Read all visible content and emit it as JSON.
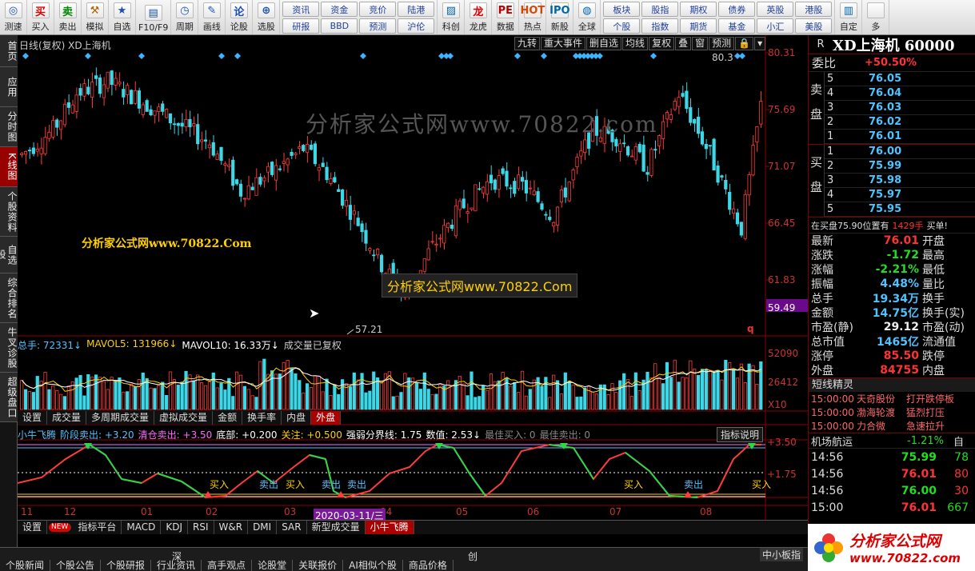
{
  "toolbar": {
    "items": [
      {
        "label": "测速",
        "icon": "speed-icon",
        "glyph": "◎",
        "color": "#1a4fb0"
      },
      {
        "label": "买入",
        "icon": "buy-icon",
        "glyph": "买",
        "color": "#d00"
      },
      {
        "label": "卖出",
        "icon": "sell-icon",
        "glyph": "卖",
        "color": "#080"
      },
      {
        "label": "模拟",
        "icon": "hammer-icon",
        "glyph": "⚒",
        "color": "#b06000"
      },
      {
        "label": "自选",
        "icon": "star-icon",
        "glyph": "★",
        "color": "#1a4fb0"
      },
      {
        "label": "F10/F9",
        "icon": "f10-icon",
        "glyph": "▤",
        "color": "#1a4fb0"
      },
      {
        "label": "周期",
        "icon": "clock-icon",
        "glyph": "◷",
        "color": "#1a4fb0"
      },
      {
        "label": "画线",
        "icon": "pen-icon",
        "glyph": "✎",
        "color": "#1a4fb0"
      },
      {
        "label": "论股",
        "icon": "forum-icon",
        "glyph": "论",
        "color": "#1a4fb0"
      },
      {
        "label": "选股",
        "icon": "search-icon",
        "glyph": "⊕",
        "color": "#1a4fb0"
      }
    ],
    "grid1": [
      "资讯",
      "资金",
      "竞价",
      "陆港",
      "研报",
      "BBD",
      "预测",
      "沪伦"
    ],
    "icons2": [
      {
        "label": "科创",
        "icon": "chart-icon",
        "glyph": "▨",
        "color": "#06a"
      },
      {
        "label": "龙虎",
        "icon": "dragon-icon",
        "glyph": "龙",
        "color": "#d00"
      },
      {
        "label": "数据",
        "icon": "pe-icon",
        "glyph": "PE",
        "color": "#b00"
      },
      {
        "label": "热点",
        "icon": "hot-icon",
        "glyph": "HOT",
        "color": "#d40"
      },
      {
        "label": "新股",
        "icon": "ipo-icon",
        "glyph": "IPO",
        "color": "#06a"
      },
      {
        "label": "全球",
        "icon": "globe-icon",
        "glyph": "◍",
        "color": "#06a"
      }
    ],
    "grid2": [
      "板块",
      "股指",
      "期权",
      "债券",
      "英股",
      "港股",
      "个股",
      "指数",
      "期货",
      "基金",
      "小汇",
      "美股"
    ],
    "tail": [
      {
        "label": "自定",
        "icon": "custom-icon",
        "glyph": "▥",
        "color": "#06a"
      },
      {
        "label": "多",
        "icon": "more-icon",
        "glyph": "",
        "color": "#06a"
      }
    ]
  },
  "sidetabs": [
    "首页",
    "应用",
    "分时图",
    "K线图",
    "个股资料",
    "自选股",
    "综合排名",
    "牛叉诊股",
    "超级盘口"
  ],
  "active_sidetab": 3,
  "main_chart": {
    "header_left": "日线(复权) XD上海机",
    "toolbar_buttons": [
      "九转",
      "重大事件",
      "删自选",
      "均线",
      "复权",
      "叠",
      "窗",
      "预测",
      "🔒",
      "▾"
    ],
    "price_labels": [
      "80.31",
      "75.69",
      "71.07",
      "66.45",
      "61.83",
      "59.49"
    ],
    "high_label": "80.3",
    "low_label": "57.21",
    "watermark": "分析家公式网www.70822.com",
    "watermark2": "分析家公式网www.70822.Com",
    "tooltip": "分析家公式网www.70822.Com",
    "q_mark": "q"
  },
  "volume_panel": {
    "header_segments": [
      {
        "text": "总手: 72331↓",
        "color": "#4fc3ff"
      },
      {
        "text": "MAVOL5: 131966↓",
        "color": "#ffd000"
      },
      {
        "text": "MAVOL10: 16.33万↓",
        "color": "#ffffff"
      },
      {
        "text": "成交量已复权",
        "color": "#cccccc"
      }
    ],
    "scale_labels": [
      "52090",
      "26412",
      "X10"
    ],
    "tabs": [
      "设置",
      "成交量",
      "多周期成交量",
      "虚拟成交量",
      "金额",
      "换手率",
      "内盘",
      "外盘"
    ],
    "active_tab": 7
  },
  "indicator_panel": {
    "header_segments": [
      {
        "text": "小牛飞腾",
        "color": "#4fc3ff"
      },
      {
        "text": "阶段卖出: +3.20",
        "color": "#4fc3ff"
      },
      {
        "text": "清仓卖出: +3.50",
        "color": "#ff66ff"
      },
      {
        "text": "底部: +0.200",
        "color": "#ffffff"
      },
      {
        "text": "关注: +0.500",
        "color": "#ffd000"
      },
      {
        "text": "强弱分界线: 1.75",
        "color": "#ffffff"
      },
      {
        "text": "数值: 2.53↓",
        "color": "#ffffff"
      },
      {
        "text": "最佳买入: 0",
        "color": "#888888"
      },
      {
        "text": "最佳卖出: 0",
        "color": "#888888"
      }
    ],
    "help_button": "指标说明",
    "scale_labels": [
      "+3.50",
      "+1.75"
    ],
    "signals": [
      {
        "text": "买入",
        "color": "#ffd000"
      },
      {
        "text": "卖出",
        "color": "#4fc3ff"
      },
      {
        "text": "买入",
        "color": "#ffd000"
      },
      {
        "text": "卖出",
        "color": "#4fc3ff"
      },
      {
        "text": "买入",
        "color": "#ffd000"
      },
      {
        "text": "卖出",
        "color": "#4fc3ff"
      },
      {
        "text": "买入",
        "color": "#ffd000"
      },
      {
        "text": "卖出",
        "color": "#4fc3ff"
      }
    ]
  },
  "date_axis": {
    "labels": [
      "11",
      "12",
      "01",
      "02",
      "03",
      "04",
      "05",
      "06",
      "07",
      "08"
    ],
    "cursor_date": "2020-03-11/三"
  },
  "indicator_tabs": {
    "items": [
      "设置",
      "NEW",
      "指标平台",
      "MACD",
      "KDJ",
      "RSI",
      "W&R",
      "DMI",
      "SAR",
      "新型成交量",
      "小牛飞腾"
    ],
    "active": 10
  },
  "statusbar": {
    "items": [
      "个股新闻",
      "个股公告",
      "个股研报",
      "行业资讯",
      "高手观点",
      "论股堂",
      "关联报价",
      "AI相似个股",
      "商品价格"
    ],
    "market_left": "深",
    "market_mid": "创",
    "right_label": "中小板指"
  },
  "quote": {
    "header_r": "R",
    "title": "XD上海机 60000",
    "weibi_label": "委比",
    "weibi_value": "+50.50%",
    "sell_label": "卖盘",
    "buy_label": "买盘",
    "sells": [
      {
        "level": "5",
        "price": "76.05"
      },
      {
        "level": "4",
        "price": "76.04"
      },
      {
        "level": "3",
        "price": "76.03"
      },
      {
        "level": "2",
        "price": "76.02"
      },
      {
        "level": "1",
        "price": "76.01"
      }
    ],
    "buys": [
      {
        "level": "1",
        "price": "76.00"
      },
      {
        "level": "2",
        "price": "75.99"
      },
      {
        "level": "3",
        "price": "75.98"
      },
      {
        "level": "4",
        "price": "75.97"
      },
      {
        "level": "5",
        "price": "75.95"
      }
    ],
    "notice_a": "在买盘75.90位置有",
    "notice_b": "1429手",
    "notice_c": "买单!",
    "stats": [
      {
        "l1": "最新",
        "v1": "76.01",
        "c1": "#ff3333",
        "l2": "开盘"
      },
      {
        "l1": "涨跌",
        "v1": "-1.72",
        "c1": "#22dd22",
        "l2": "最高"
      },
      {
        "l1": "涨幅",
        "v1": "-2.21%",
        "c1": "#22dd22",
        "l2": "最低"
      },
      {
        "l1": "振幅",
        "v1": "4.48%",
        "c1": "#4fc3ff",
        "l2": "量比"
      },
      {
        "l1": "总手",
        "v1": "19.34万",
        "c1": "#4fc3ff",
        "l2": "换手"
      },
      {
        "l1": "金额",
        "v1": "14.75亿",
        "c1": "#4fc3ff",
        "l2": "换手(实)"
      },
      {
        "l1": "市盈(静)",
        "v1": "29.12",
        "c1": "#eeeeee",
        "l2": "市盈(动)"
      },
      {
        "l1": "总市值",
        "v1": "1465亿",
        "c1": "#4fc3ff",
        "l2": "流通值"
      },
      {
        "l1": "涨停",
        "v1": "85.50",
        "c1": "#ff3333",
        "l2": "跌停"
      },
      {
        "l1": "外盘",
        "v1": "84755",
        "c1": "#ff3333",
        "l2": "内盘"
      }
    ],
    "elves_title": "短线精灵",
    "elves": [
      {
        "time": "15:00:00",
        "name": "天奇股份",
        "event": "打开跌停板"
      },
      {
        "time": "15:00:00",
        "name": "渤海轮渡",
        "event": "猛烈打压"
      },
      {
        "time": "15:00:00",
        "name": "力合微",
        "event": "急速拉升"
      }
    ],
    "jh_name": "机场航运",
    "jh_change": "-1.21%",
    "jh_tail": "自",
    "ticks": [
      {
        "time": "14:56",
        "price": "75.99",
        "vol": "78"
      },
      {
        "time": "14:56",
        "price": "76.01",
        "vol": "80"
      },
      {
        "time": "14:56",
        "price": "76.00",
        "vol": "30"
      },
      {
        "time": "15:00",
        "price": "76.01",
        "vol": "667"
      }
    ]
  },
  "corner_logo": {
    "text": "分析家公式网",
    "url": "www.70822.com"
  }
}
